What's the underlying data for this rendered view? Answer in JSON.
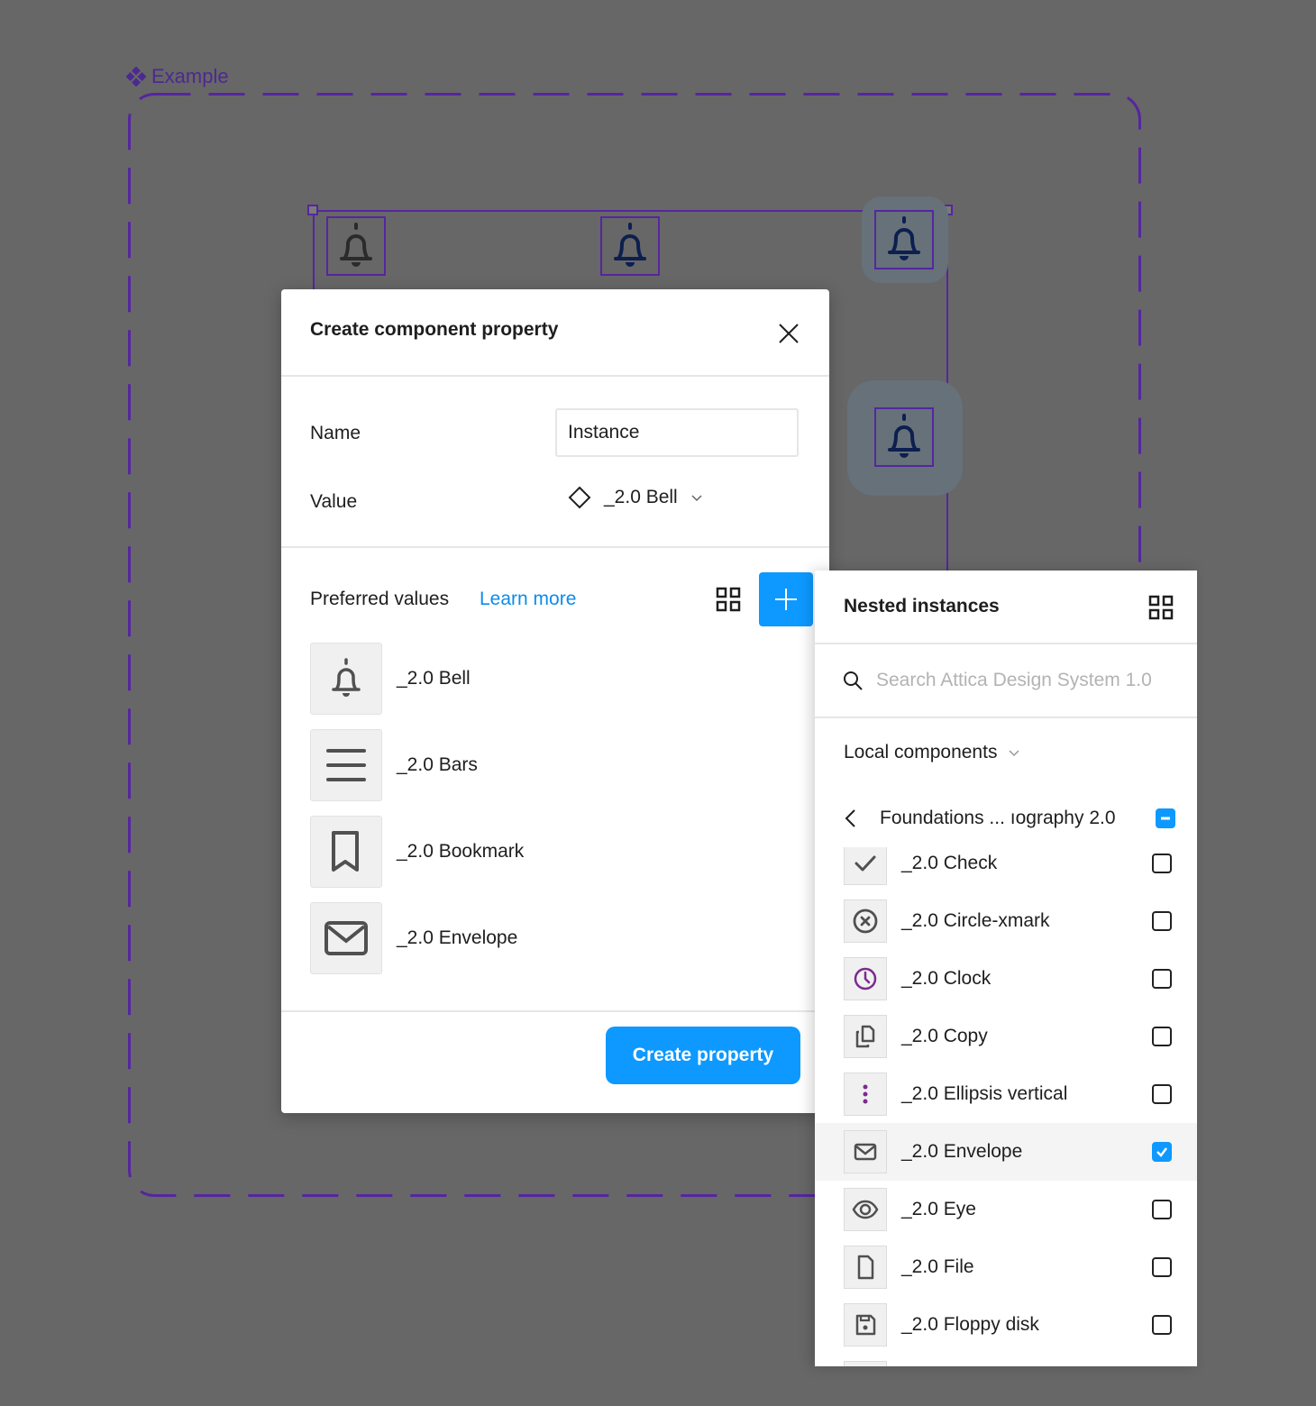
{
  "canvas": {
    "frame_label": "Example",
    "frame_icon": "component-icon",
    "accent_color": "#5526a0",
    "instances": [
      {
        "icon": "bell-icon",
        "color": "#2b2b2b"
      },
      {
        "icon": "bell-icon",
        "color": "#0c1f4f"
      },
      {
        "icon": "bell-icon",
        "color": "#0c1f4f",
        "highlighted": true
      },
      {
        "icon": "bell-icon",
        "color": "#0c1f4f",
        "highlighted": true
      }
    ]
  },
  "dialog": {
    "title": "Create component property",
    "close_icon": "close-icon",
    "name_label": "Name",
    "name_value": "Instance",
    "value_label": "Value",
    "value_selected": "_2.0 Bell",
    "preferred_title": "Preferred values",
    "learn_more": "Learn more",
    "preferred_values": [
      {
        "label": "_2.0 Bell",
        "icon": "bell-icon"
      },
      {
        "label": "_2.0 Bars",
        "icon": "bars-icon"
      },
      {
        "label": "_2.0 Bookmark",
        "icon": "bookmark-icon"
      },
      {
        "label": "_2.0 Envelope",
        "icon": "envelope-icon"
      }
    ],
    "create_button": "Create property",
    "primary_color": "#0d99ff",
    "link_color": "#0d8ce9"
  },
  "nested_panel": {
    "title": "Nested instances",
    "search_placeholder": "Search Attica Design System 1.0",
    "library_select": "Local components",
    "breadcrumb": "Foundations ... ıography 2.0",
    "breadcrumb_checkbox": "indeterminate",
    "items": [
      {
        "label": "_2.0 Check",
        "icon": "check-icon",
        "checked": false
      },
      {
        "label": "_2.0 Circle-xmark",
        "icon": "circle-xmark-icon",
        "checked": false
      },
      {
        "label": "_2.0 Clock",
        "icon": "clock-icon",
        "checked": false
      },
      {
        "label": "_2.0 Copy",
        "icon": "copy-icon",
        "checked": false
      },
      {
        "label": "_2.0 Ellipsis vertical",
        "icon": "ellipsis-vertical-icon",
        "checked": false
      },
      {
        "label": "_2.0 Envelope",
        "icon": "envelope-icon",
        "checked": true
      },
      {
        "label": "_2.0 Eye",
        "icon": "eye-icon",
        "checked": false
      },
      {
        "label": "_2.0 File",
        "icon": "file-icon",
        "checked": false
      },
      {
        "label": "_2.0 Floppy disk",
        "icon": "floppy-disk-icon",
        "checked": false
      },
      {
        "label": "",
        "icon": "unknown-icon",
        "checked": false
      }
    ]
  }
}
